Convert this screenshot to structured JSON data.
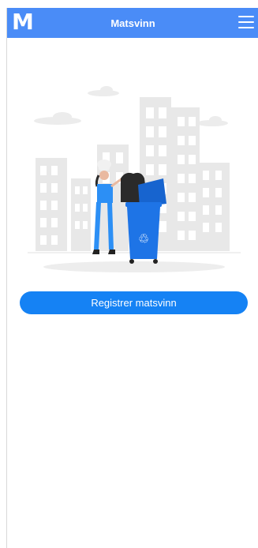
{
  "app": {
    "logo_letter": "M",
    "title": "Matsvinn"
  },
  "header": {
    "menu_icon": "hamburger-menu-icon"
  },
  "illustration": {
    "description_icon": "recycle-icon"
  },
  "actions": {
    "register_label": "Registrer matsvinn"
  },
  "colors": {
    "brand": "#4a8cf7",
    "button": "#1582f4",
    "bin": "#1e74e6"
  }
}
